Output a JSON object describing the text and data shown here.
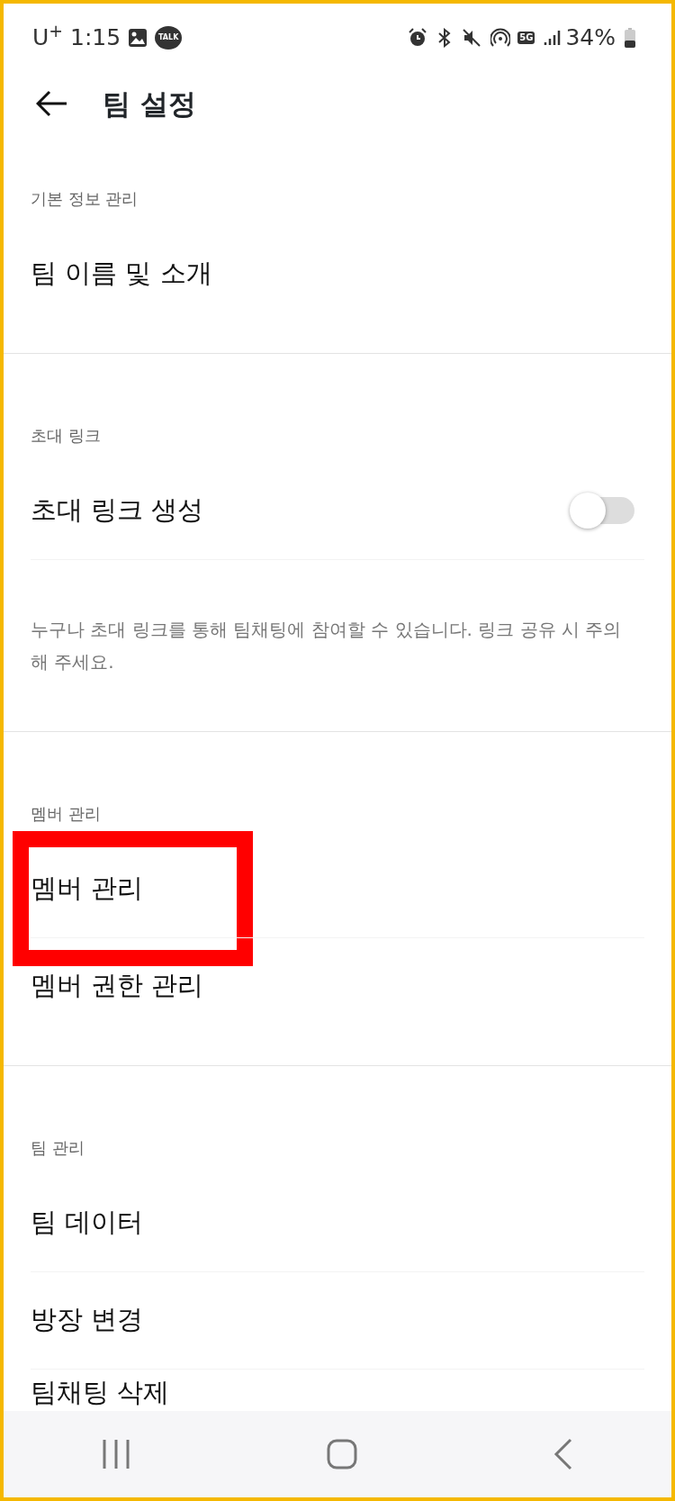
{
  "status_bar": {
    "carrier": "U$^{+}$",
    "time": "1:15",
    "talk_label": "TALK",
    "network": "5G",
    "battery": "34%"
  },
  "header": {
    "title": "팀 설정"
  },
  "sections": [
    {
      "label": "기본 정보 관리",
      "items": [
        {
          "kind": "link",
          "label": "팀 이름 및 소개",
          "highlighted": false
        }
      ]
    },
    {
      "label": "초대 링크",
      "items": [
        {
          "kind": "toggle",
          "label": "초대 링크 생성",
          "on": false,
          "highlighted": false
        }
      ],
      "description": "누구나 초대 링크를 통해 팀채팅에 참여할 수 있습니다. 링크 공유 시 주의해 주세요."
    },
    {
      "label": "멤버 관리",
      "items": [
        {
          "kind": "link",
          "label": "멤버 관리",
          "highlighted": true
        },
        {
          "kind": "link",
          "label": "멤버 권한 관리",
          "highlighted": false
        }
      ]
    },
    {
      "label": "팀 관리",
      "items": [
        {
          "kind": "link",
          "label": "팀 데이터",
          "highlighted": false
        },
        {
          "kind": "link",
          "label": "방장 변경",
          "highlighted": false
        },
        {
          "kind": "link",
          "label": "팀채팅 삭제",
          "highlighted": false
        }
      ]
    }
  ]
}
